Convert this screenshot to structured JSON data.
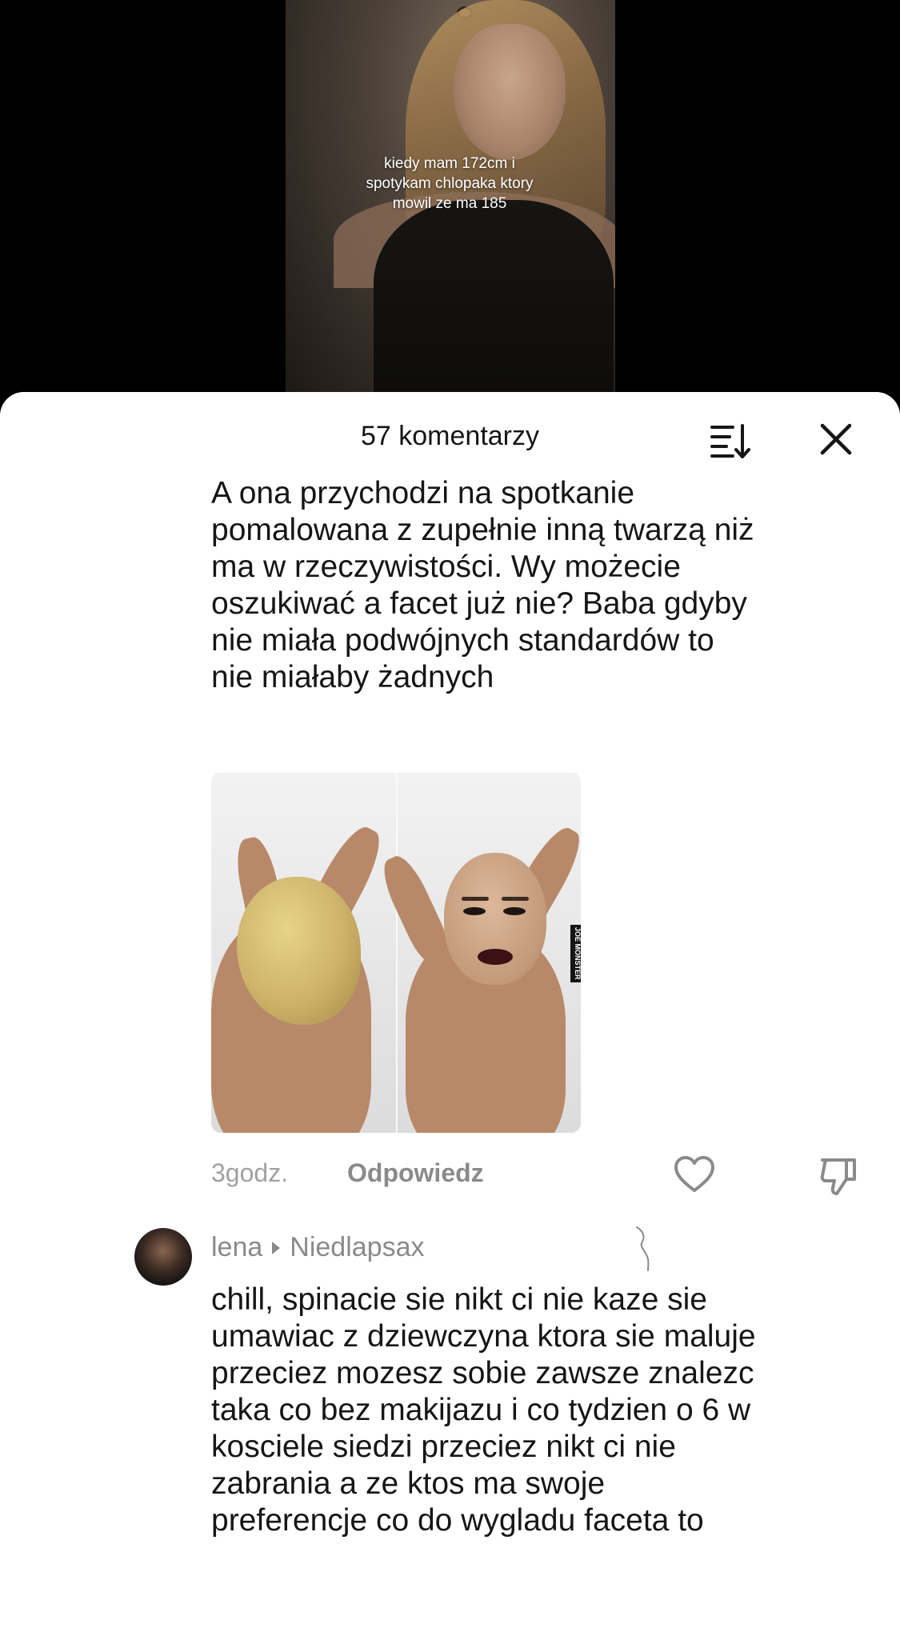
{
  "video": {
    "caption": "kiedy mam 172cm i\nspotykam chlopaka ktory\nmowil ze ma 185"
  },
  "comments_sheet": {
    "title": "57 komentarzy",
    "sort_icon": "sort-icon",
    "close_icon": "close-icon"
  },
  "comment1": {
    "text": "A ona przychodzi na spotkanie\npomalowana z zupełnie inną twarzą niż\nma w rzeczywistości. Wy możecie\noszukiwać a facet już nie? Baba gdyby\nnie miała podwójnych standardów to\nnie miałaby żadnych",
    "image_watermark": "JOE MONSTER",
    "time": "3godz.",
    "reply_label": "Odpowiedz",
    "like_icon": "heart-icon",
    "dislike_icon": "thumbs-down-icon"
  },
  "comment2": {
    "author": "lena",
    "reply_to": "Niedlapsax",
    "text": "chill, spinacie sie nikt ci nie kaze sie\numawiac z dziewczyna ktora sie maluje\nprzeciez mozesz sobie zawsze znalezc\ntaka co bez makijazu i co tydzien o 6 w\nkosciele siedzi przeciez nikt ci nie\nzabrania a ze ktos ma swoje\npreferencje co do wygladu faceta to"
  },
  "colors": {
    "sheet_bg": "#ffffff",
    "text_primary": "#161616",
    "text_secondary": "#8a8a8a",
    "time_text": "#a1a1a1"
  }
}
